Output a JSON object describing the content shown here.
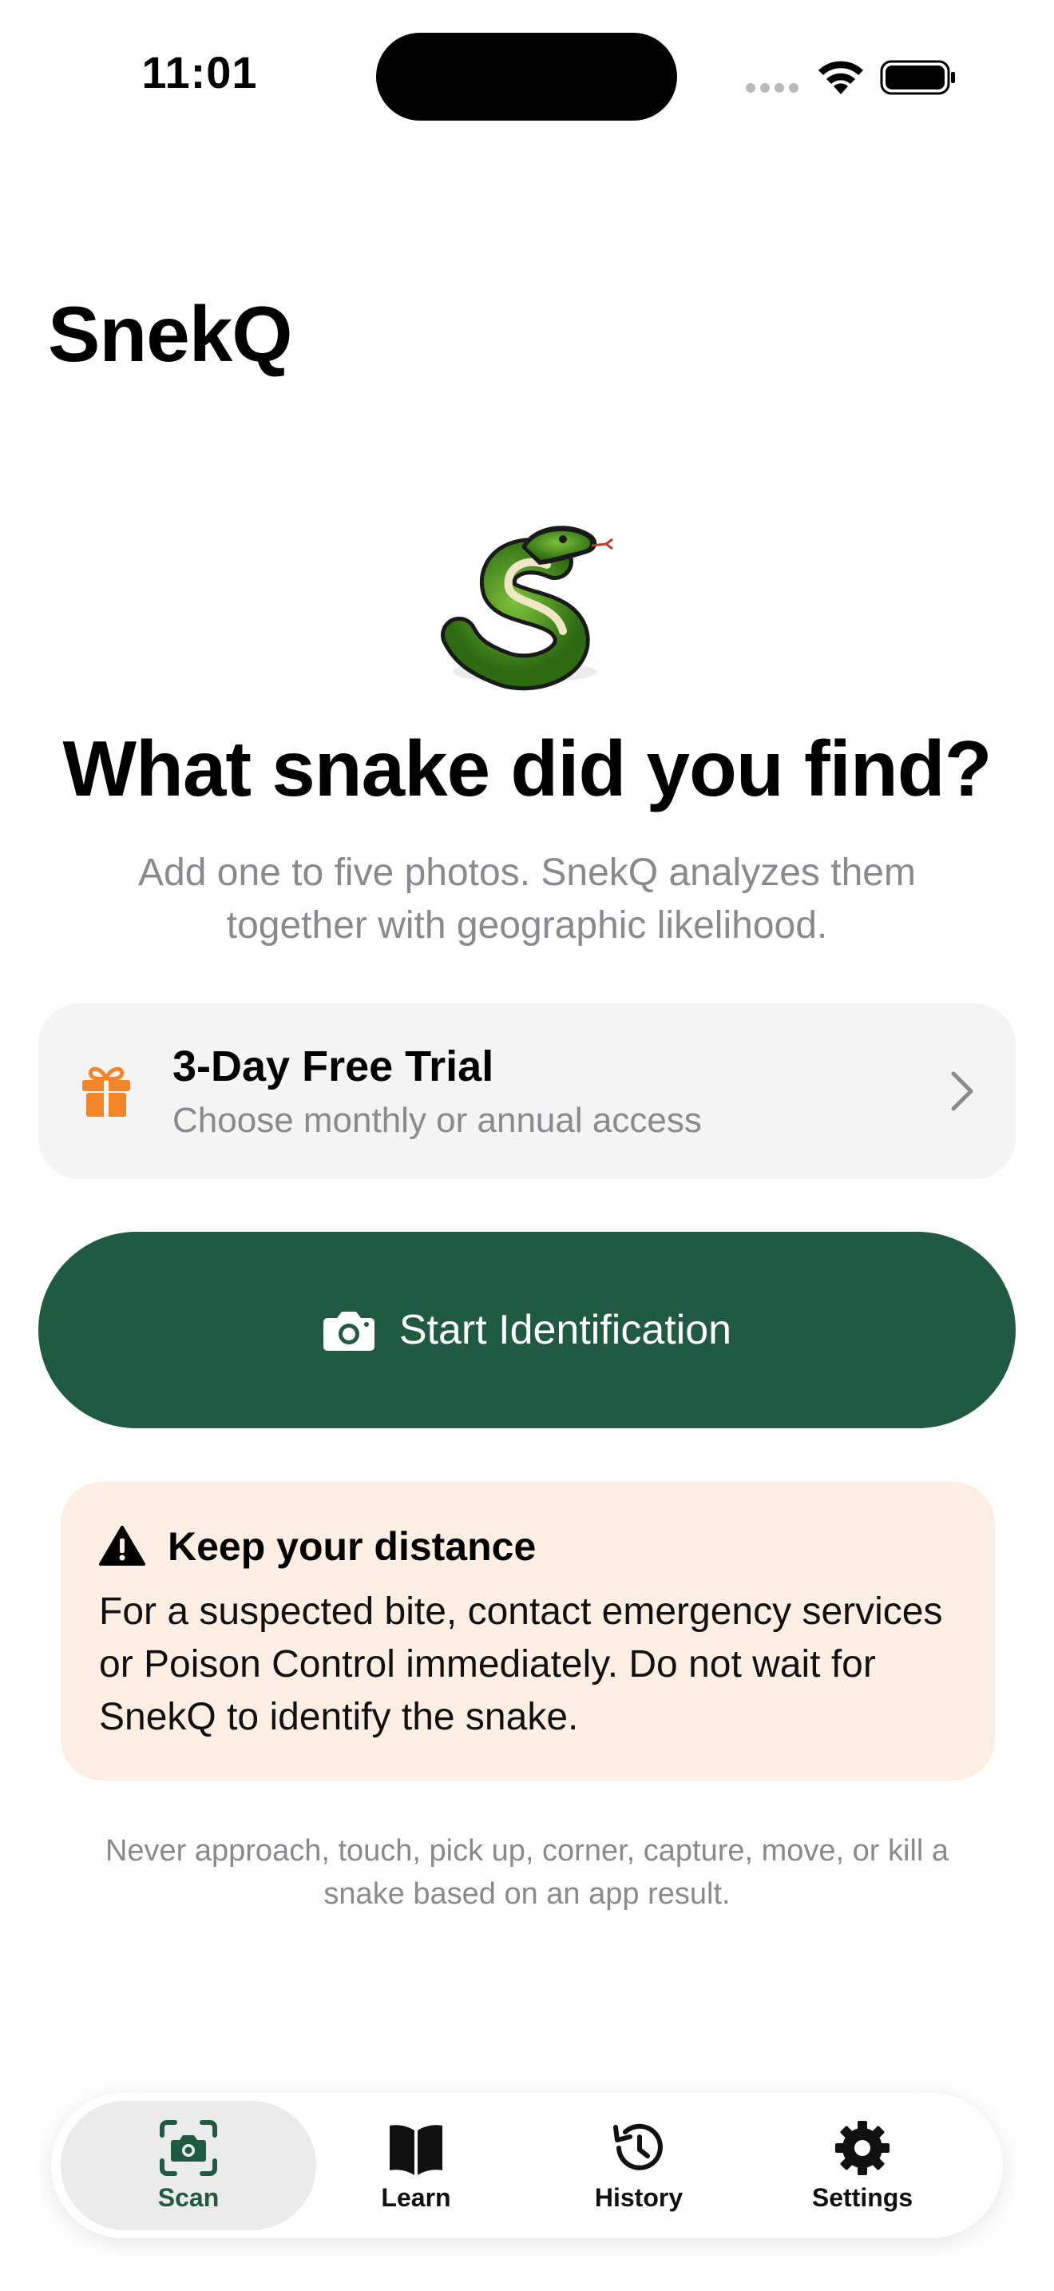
{
  "status_bar": {
    "time": "11:01"
  },
  "app": {
    "title": "SnekQ"
  },
  "hero": {
    "headline": "What snake did you find?",
    "subtitle": "Add one to five photos. SnekQ analyzes them together with geographic likelihood."
  },
  "trial": {
    "title": "3-Day Free Trial",
    "subtitle": "Choose monthly or annual access",
    "icon": "gift-icon"
  },
  "primary_action": {
    "label": "Start Identification",
    "icon": "camera-icon"
  },
  "warning": {
    "title": "Keep your distance",
    "body": "For a suspected bite, contact emergency services or Poison Control immediately. Do not wait for SnekQ to identify the snake.",
    "icon": "warning-triangle-icon"
  },
  "footnote": "Never approach, touch, pick up, corner, capture, move, or kill a snake based on an app result.",
  "tab_bar": {
    "tabs": [
      {
        "label": "Scan",
        "icon": "scan-camera-icon",
        "active": true
      },
      {
        "label": "Learn",
        "icon": "book-icon",
        "active": false
      },
      {
        "label": "History",
        "icon": "history-clock-icon",
        "active": false
      },
      {
        "label": "Settings",
        "icon": "gear-icon",
        "active": false
      }
    ]
  },
  "colors": {
    "brand_green": "#215a43",
    "gift_orange": "#f0852a",
    "warning_bg": "#fdeee3",
    "card_bg": "#f4f4f5",
    "secondary_text": "#8a8a8e"
  }
}
